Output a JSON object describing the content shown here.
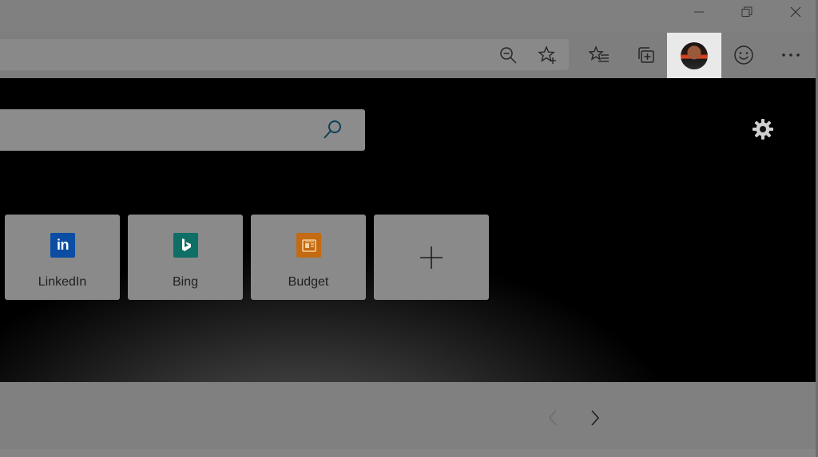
{
  "window_controls": {
    "minimize_icon": "minimize-icon",
    "restore_icon": "restore-icon",
    "close_icon": "close-icon"
  },
  "toolbar": {
    "zoom_out_icon": "zoom-out-icon",
    "add_favorite_icon": "star-plus-icon",
    "favorites_icon": "favorites-list-icon",
    "collections_icon": "collections-icon",
    "profile_icon": "avatar",
    "feedback_icon": "smiley-icon",
    "more_icon": "ellipsis-icon"
  },
  "new_tab": {
    "search_icon": "search-icon",
    "settings_icon": "gear-icon",
    "tiles": [
      {
        "label": "LinkedIn",
        "icon": "linkedin-icon",
        "color": "#0a4da3"
      },
      {
        "label": "Bing",
        "icon": "bing-icon",
        "color": "#0f6e66"
      },
      {
        "label": "Budget",
        "icon": "office-icon",
        "color": "#c46a12"
      },
      {
        "label": "",
        "icon": "plus-icon"
      }
    ]
  },
  "feed_nav": {
    "prev_icon": "chevron-left-icon",
    "next_icon": "chevron-right-icon"
  }
}
